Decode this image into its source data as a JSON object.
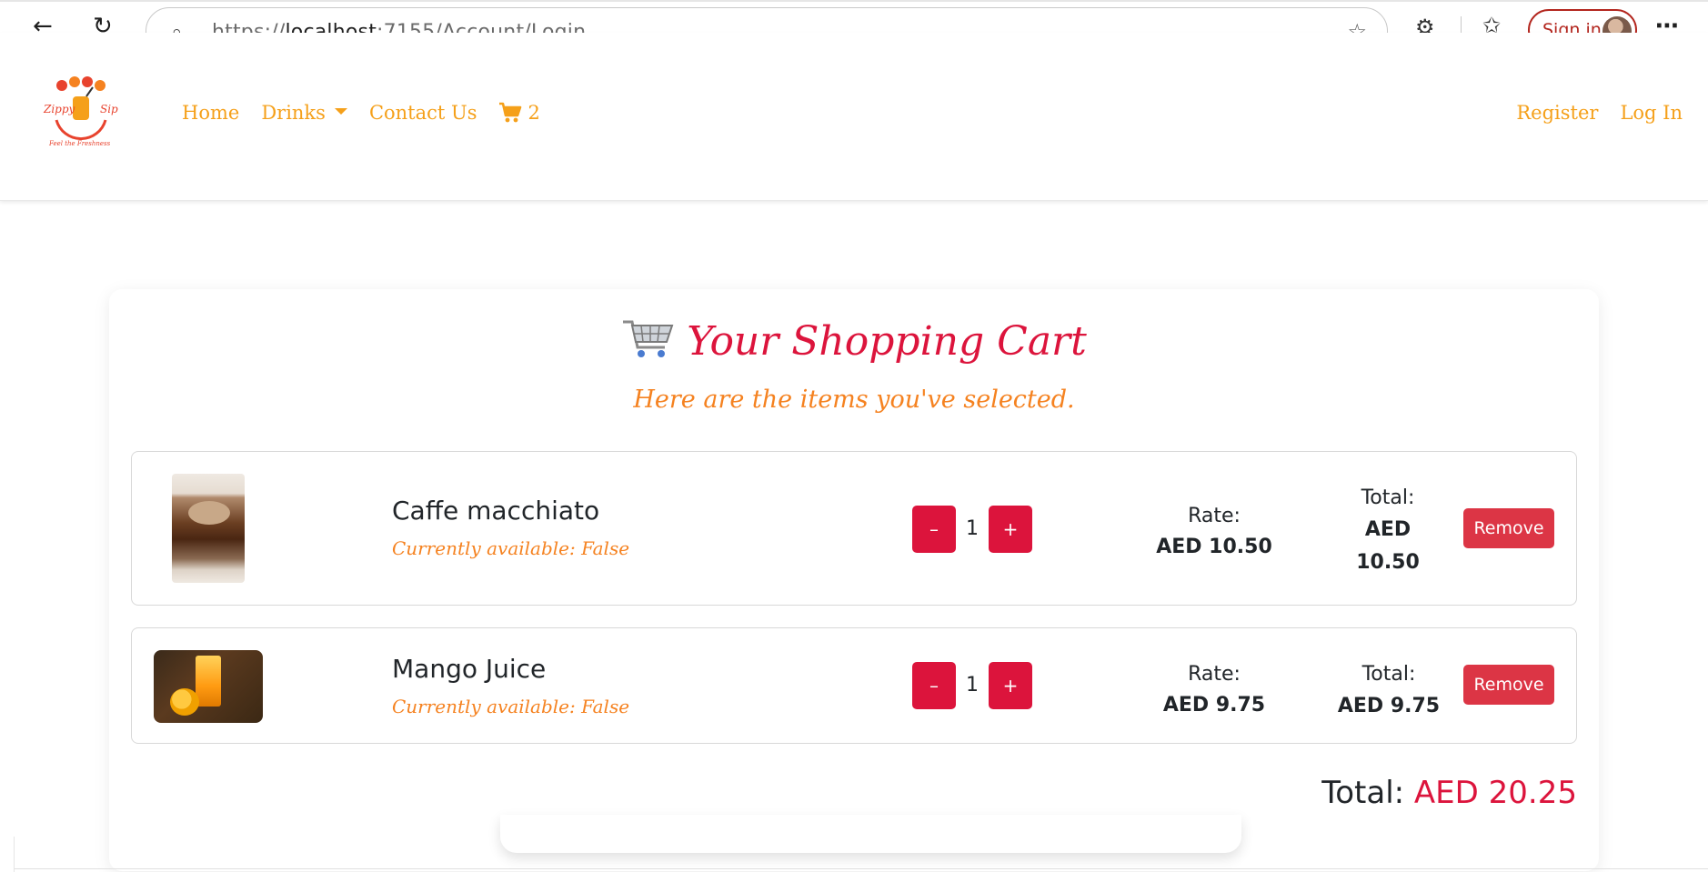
{
  "browser": {
    "url_prefix": "https://",
    "url_host": "localhost",
    "url_rest": ":7155/Account/Login",
    "signin_label": "Sign in"
  },
  "navbar": {
    "logo_text_left": "Zippy",
    "logo_text_right": "Sip",
    "logo_tagline": "Feel the Freshness",
    "links": {
      "home": "Home",
      "drinks": "Drinks",
      "contact": "Contact Us",
      "cart_count": "2"
    },
    "right": {
      "register": "Register",
      "login": "Log In"
    }
  },
  "cart": {
    "title": "Your Shopping Cart",
    "subtitle": "Here are the items you've selected.",
    "items": [
      {
        "name": "Caffe macchiato",
        "availability": "Currently available: False",
        "qty_minus": "–",
        "quantity": "1",
        "qty_plus": "+",
        "rate_label": "Rate:",
        "rate": "AED 10.50",
        "total_label": "Total:",
        "total": "AED 10.50",
        "remove_label": "Remove"
      },
      {
        "name": "Mango Juice",
        "availability": "Currently available: False",
        "qty_minus": "–",
        "quantity": "1",
        "qty_plus": "+",
        "rate_label": "Rate:",
        "rate": "AED 9.75",
        "total_label": "Total:",
        "total": "AED 9.75",
        "remove_label": "Remove"
      }
    ],
    "grand_total_label": "Total:",
    "grand_total_value": "AED 20.25"
  },
  "colors": {
    "accent_orange": "#f5a01a",
    "accent_red": "#dc143c",
    "remove_red": "#dc3545"
  }
}
